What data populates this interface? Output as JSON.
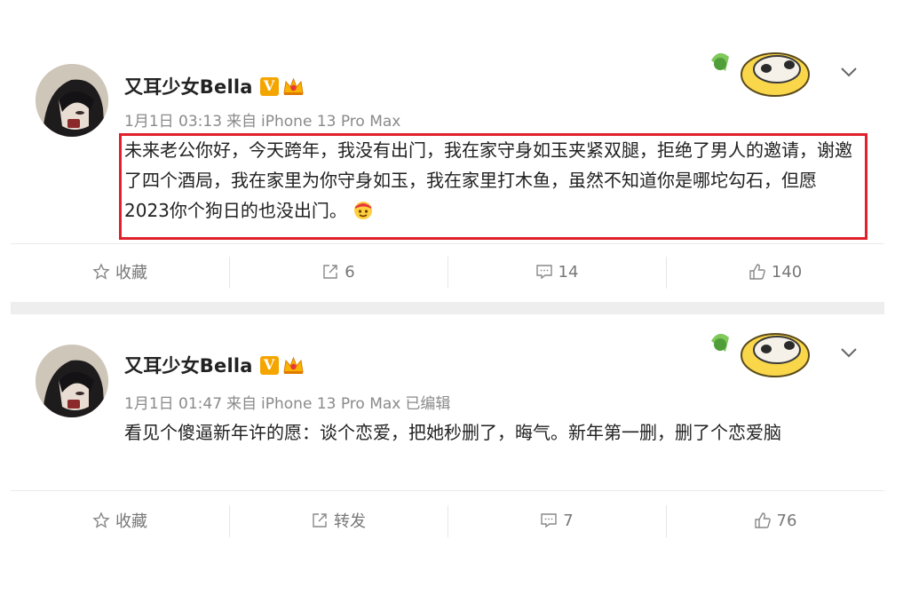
{
  "posts": [
    {
      "user": {
        "name": "又耳少女Bella",
        "verified_badge": "V"
      },
      "meta": {
        "date": "1月1日 03:13",
        "source_prefix": "来自",
        "source": "iPhone 13 Pro Max",
        "edited": ""
      },
      "text": "未来老公你好，今天跨年，我没有出门，我在家守身如玉夹紧双腿，拒绝了男人的邀请，谢邀了四个酒局，我在家里为你守身如玉，我在家里打木鱼，虽然不知道你是哪坨勾石，但愿2023你个狗日的也没出门。",
      "highlighted": true,
      "actions": {
        "favorite": "收藏",
        "repost": "6",
        "comment": "14",
        "like": "140"
      }
    },
    {
      "user": {
        "name": "又耳少女Bella",
        "verified_badge": "V"
      },
      "meta": {
        "date": "1月1日 01:47",
        "source_prefix": "来自",
        "source": "iPhone 13 Pro Max",
        "edited": "已编辑"
      },
      "text": "看见个傻逼新年许的愿：谈个恋爱，把她秒删了，晦气。新年第一删，删了个恋爱脑",
      "highlighted": false,
      "actions": {
        "favorite": "收藏",
        "repost": "转发",
        "comment": "7",
        "like": "76"
      }
    }
  ],
  "colors": {
    "highlight_border": "#e0202b",
    "badge": "#f5a500",
    "meta_text": "#8a8a8a"
  },
  "icons": [
    "star-icon",
    "repost-icon",
    "comment-icon",
    "like-icon",
    "chevron-down-icon",
    "crown-icon",
    "sticker-icon"
  ]
}
